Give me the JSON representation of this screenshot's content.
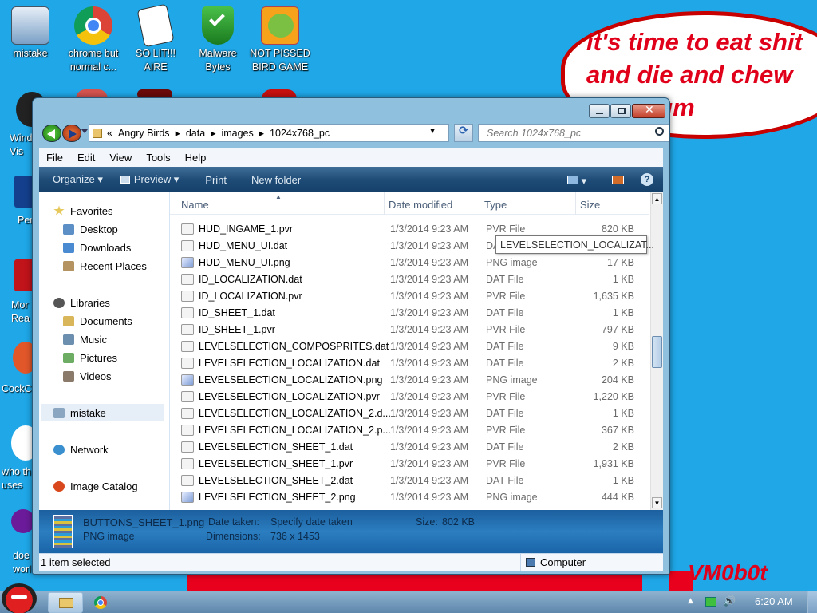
{
  "desktop": {
    "icons": [
      {
        "label": "mistake",
        "icon": "computer-icon"
      },
      {
        "label": "chrome but normal c...",
        "icon": "chrome-icon"
      },
      {
        "label": "SO LIT!!! AIRE",
        "icon": "solitaire-icon"
      },
      {
        "label": "Malware Bytes",
        "icon": "shield-icon"
      },
      {
        "label": "NOT PISSED BIRD GAME",
        "icon": "pig-icon"
      }
    ],
    "partial_labels": {
      "windows": "Windo\nVis",
      "per": "Per",
      "more": "Mor\nRea",
      "cockc": "CockC",
      "who": "who th\nuses",
      "doe": "doe\nworl"
    },
    "speech_bubble": {
      "line1": "it's time to eat shit",
      "line2": "and die and chew",
      "line3": "bubble gum"
    },
    "signature": "VM0b0t"
  },
  "explorer": {
    "breadcrumb": [
      "«",
      "Angry Birds",
      "data",
      "images",
      "1024x768_pc"
    ],
    "search_placeholder": "Search 1024x768_pc",
    "menu": [
      "File",
      "Edit",
      "View",
      "Tools",
      "Help"
    ],
    "toolbar": {
      "organize": "Organize",
      "preview": "Preview",
      "print": "Print",
      "new_folder": "New folder"
    },
    "nav": {
      "favorites": "Favorites",
      "desktop": "Desktop",
      "downloads": "Downloads",
      "recent": "Recent Places",
      "libraries": "Libraries",
      "documents": "Documents",
      "music": "Music",
      "pictures": "Pictures",
      "videos": "Videos",
      "mistake": "mistake",
      "network": "Network",
      "image_catalog": "Image Catalog"
    },
    "columns": {
      "name": "Name",
      "date": "Date modified",
      "type": "Type",
      "size": "Size"
    },
    "files": [
      {
        "name": "HUD_INGAME_1.pvr",
        "date": "1/3/2014 9:23 AM",
        "type": "PVR File",
        "size": "820 KB",
        "png": false
      },
      {
        "name": "HUD_MENU_UI.dat",
        "date": "1/3/2014 9:23 AM",
        "type": "DA",
        "size": "",
        "png": false
      },
      {
        "name": "HUD_MENU_UI.png",
        "date": "1/3/2014 9:23 AM",
        "type": "PNG image",
        "size": "17 KB",
        "png": true
      },
      {
        "name": "ID_LOCALIZATION.dat",
        "date": "1/3/2014 9:23 AM",
        "type": "DAT File",
        "size": "1 KB",
        "png": false
      },
      {
        "name": "ID_LOCALIZATION.pvr",
        "date": "1/3/2014 9:23 AM",
        "type": "PVR File",
        "size": "1,635 KB",
        "png": false
      },
      {
        "name": "ID_SHEET_1.dat",
        "date": "1/3/2014 9:23 AM",
        "type": "DAT File",
        "size": "1 KB",
        "png": false
      },
      {
        "name": "ID_SHEET_1.pvr",
        "date": "1/3/2014 9:23 AM",
        "type": "PVR File",
        "size": "797 KB",
        "png": false
      },
      {
        "name": "LEVELSELECTION_COMPOSPRITES.dat",
        "date": "1/3/2014 9:23 AM",
        "type": "DAT File",
        "size": "9 KB",
        "png": false
      },
      {
        "name": "LEVELSELECTION_LOCALIZATION.dat",
        "date": "1/3/2014 9:23 AM",
        "type": "DAT File",
        "size": "2 KB",
        "png": false
      },
      {
        "name": "LEVELSELECTION_LOCALIZATION.png",
        "date": "1/3/2014 9:23 AM",
        "type": "PNG image",
        "size": "204 KB",
        "png": true
      },
      {
        "name": "LEVELSELECTION_LOCALIZATION.pvr",
        "date": "1/3/2014 9:23 AM",
        "type": "PVR File",
        "size": "1,220 KB",
        "png": false
      },
      {
        "name": "LEVELSELECTION_LOCALIZATION_2.d...",
        "date": "1/3/2014 9:23 AM",
        "type": "DAT File",
        "size": "1 KB",
        "png": false
      },
      {
        "name": "LEVELSELECTION_LOCALIZATION_2.p...",
        "date": "1/3/2014 9:23 AM",
        "type": "PVR File",
        "size": "367 KB",
        "png": false
      },
      {
        "name": "LEVELSELECTION_SHEET_1.dat",
        "date": "1/3/2014 9:23 AM",
        "type": "DAT File",
        "size": "2 KB",
        "png": false
      },
      {
        "name": "LEVELSELECTION_SHEET_1.pvr",
        "date": "1/3/2014 9:23 AM",
        "type": "PVR File",
        "size": "1,931 KB",
        "png": false
      },
      {
        "name": "LEVELSELECTION_SHEET_2.dat",
        "date": "1/3/2014 9:23 AM",
        "type": "DAT File",
        "size": "1 KB",
        "png": false
      },
      {
        "name": "LEVELSELECTION_SHEET_2.png",
        "date": "1/3/2014 9:23 AM",
        "type": "PNG image",
        "size": "444 KB",
        "png": true
      }
    ],
    "tooltip": "LEVELSELECTION_LOCALIZAT...",
    "details": {
      "filename": "BUTTONS_SHEET_1.png",
      "filetype": "PNG image",
      "date_taken_label": "Date taken:",
      "date_taken_value": "Specify date taken",
      "dimensions_label": "Dimensions:",
      "dimensions_value": "736 x 1453",
      "size_label": "Size:",
      "size_value": "802 KB"
    },
    "status": {
      "selected": "1 item selected",
      "location": "Computer"
    }
  },
  "taskbar": {
    "clock": "6:20 AM"
  },
  "colors": {
    "desktop": "#1fa7e8",
    "bubble_text": "#e0001a",
    "toolbar": "#1f4c77"
  }
}
